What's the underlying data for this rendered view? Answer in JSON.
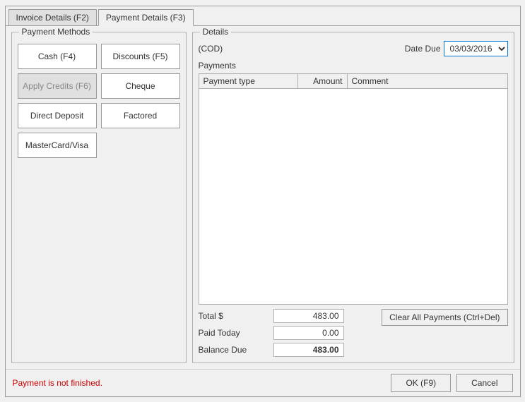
{
  "tabs": [
    {
      "id": "invoice-details",
      "label": "Invoice Details (F2)",
      "active": false
    },
    {
      "id": "payment-details",
      "label": "Payment Details (F3)",
      "active": true
    }
  ],
  "left_panel": {
    "label": "Payment Methods",
    "buttons": [
      {
        "id": "cash",
        "label": "Cash (F4)",
        "disabled": false
      },
      {
        "id": "discounts",
        "label": "Discounts (F5)",
        "disabled": false
      },
      {
        "id": "apply-credits",
        "label": "Apply Credits (F6)",
        "disabled": true
      },
      {
        "id": "cheque",
        "label": "Cheque",
        "disabled": false
      },
      {
        "id": "direct-deposit",
        "label": "Direct Deposit",
        "disabled": false
      },
      {
        "id": "factored",
        "label": "Factored",
        "disabled": false
      },
      {
        "id": "mastercard-visa",
        "label": "MasterCard/Visa",
        "disabled": false
      }
    ]
  },
  "right_panel": {
    "label": "Details",
    "cod_text": "(COD)",
    "date_due_label": "Date Due",
    "date_due_value": "03/03/2016",
    "payments_label": "Payments",
    "table": {
      "columns": [
        {
          "id": "payment-type",
          "label": "Payment type"
        },
        {
          "id": "amount",
          "label": "Amount"
        },
        {
          "id": "comment",
          "label": "Comment"
        }
      ],
      "rows": []
    },
    "totals": {
      "total_label": "Total $",
      "total_value": "483.00",
      "paid_today_label": "Paid Today",
      "paid_today_value": "0.00",
      "balance_due_label": "Balance Due",
      "balance_due_value": "483.00"
    },
    "clear_btn_label": "Clear All Payments (Ctrl+Del)"
  },
  "bottom": {
    "error_text": "Payment is not finished.",
    "ok_btn_label": "OK (F9)",
    "cancel_btn_label": "Cancel"
  }
}
